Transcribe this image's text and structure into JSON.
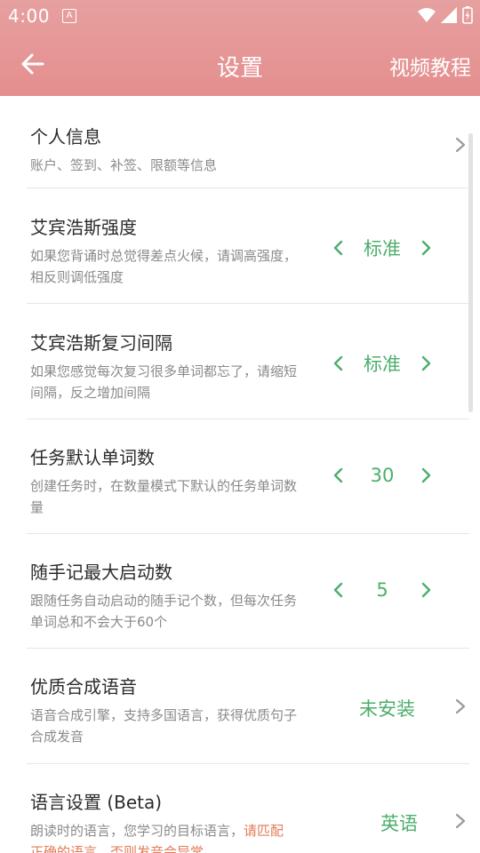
{
  "status_bar": {
    "time": "4:00",
    "notif_icon": "A"
  },
  "appbar": {
    "title": "设置",
    "right_action": "视频教程"
  },
  "colors": {
    "header": "#e69292",
    "accent_green": "#4cae6b",
    "warn_orange": "#e27b56"
  },
  "settings": [
    {
      "title": "个人信息",
      "desc": "账户、签到、补签、限额等信息",
      "control": "nav"
    },
    {
      "title": "艾宾浩斯强度",
      "desc": "如果您背诵时总觉得差点火候，请调高强度，相反则调低强度",
      "control": "stepper",
      "value": "标准"
    },
    {
      "title": "艾宾浩斯复习间隔",
      "desc": "如果您感觉每次复习很多单词都忘了，请缩短间隔，反之增加间隔",
      "control": "stepper",
      "value": "标准"
    },
    {
      "title": "任务默认单词数",
      "desc": "创建任务时，在数量模式下默认的任务单词数量",
      "control": "stepper",
      "value": "30"
    },
    {
      "title": "随手记最大启动数",
      "desc": "跟随任务自动启动的随手记个数，但每次任务单词总和不会大于60个",
      "control": "stepper",
      "value": "5"
    },
    {
      "title": "优质合成语音",
      "desc": "语音合成引擎，支持多国语言，获得优质句子合成发音",
      "control": "nav-value",
      "value": "未安装"
    },
    {
      "title": "语言设置 (Beta)",
      "desc_plain": "朗读时的语言，您学习的目标语言，",
      "desc_warn": "请匹配正确的语言，否则发音会异常",
      "control": "nav-value",
      "value": "英语"
    }
  ]
}
